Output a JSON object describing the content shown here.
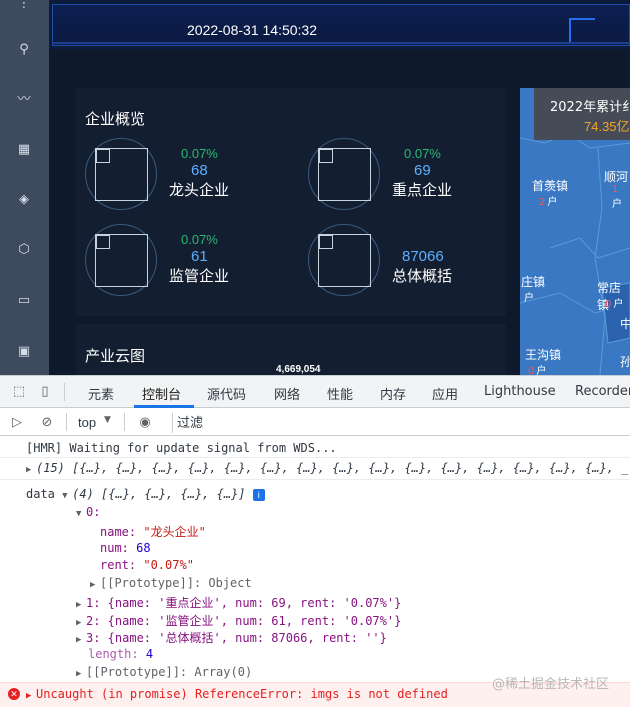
{
  "header": {
    "datetime": "2022-08-31 14:50:32"
  },
  "sidebar": {
    "items": [
      {
        "icon": "top-logo-icon",
        "glyph": "⋮"
      },
      {
        "icon": "network-icon",
        "glyph": "⚲"
      },
      {
        "icon": "trend-icon",
        "glyph": "〰"
      },
      {
        "icon": "chart-icon",
        "glyph": "▦"
      },
      {
        "icon": "cube-icon",
        "glyph": "◈"
      },
      {
        "icon": "shield-icon",
        "glyph": "⬡"
      },
      {
        "icon": "monitor-icon",
        "glyph": "▭"
      },
      {
        "icon": "briefcase-icon",
        "glyph": "▣"
      }
    ]
  },
  "overview": {
    "title": "企业概览",
    "stats": [
      {
        "rent": "0.07%",
        "num": "68",
        "name": "龙头企业"
      },
      {
        "rent": "0.07%",
        "num": "69",
        "name": "重点企业"
      },
      {
        "rent": "0.07%",
        "num": "61",
        "name": "监管企业"
      },
      {
        "rent": "",
        "num": "87066",
        "name": "总体概括"
      }
    ]
  },
  "cloud": {
    "title": "产业云图",
    "value": "4,669,054"
  },
  "map": {
    "tip_title": "2022年累计纟",
    "tip_value": "74.35亿",
    "towns": [
      {
        "name": "首羡镇",
        "count": "2",
        "unit": "户"
      },
      {
        "name": "顺河",
        "count": "1",
        "unit": "户"
      },
      {
        "name": "庄镇",
        "count": "",
        "unit": "户"
      },
      {
        "name": "常店镇",
        "count": "0",
        "unit": "户"
      },
      {
        "name": "王沟镇",
        "count": "0",
        "unit": "户"
      },
      {
        "name": "中",
        "count": "",
        "unit": ""
      },
      {
        "name": "孙",
        "count": "",
        "unit": ""
      }
    ]
  },
  "devtools": {
    "tabs": [
      "元素",
      "控制台",
      "源代码",
      "网络",
      "性能",
      "内存",
      "应用",
      "Lighthouse",
      "Recorder"
    ],
    "active_tab": "控制台",
    "context": "top",
    "filter_placeholder": "过滤",
    "console": {
      "hmr": "[HMR] Waiting for update signal from WDS...",
      "array15": "(15) [{…}, {…}, {…}, {…}, {…}, {…}, {…}, {…}, {…}, {…}, {…}, {…}, {…}, {…}, {…}, _",
      "data_label": "data",
      "data_summary": "(4) [{…}, {…}, {…}, {…}]",
      "item0_index": "0:",
      "item0_name_key": "name:",
      "item0_name_val": "\"龙头企业\"",
      "item0_num_key": "num:",
      "item0_num_val": "68",
      "item0_rent_key": "rent:",
      "item0_rent_val": "\"0.07%\"",
      "proto_object": "[[Prototype]]: Object",
      "item1": "1: {name: '重点企业', num: 69, rent: '0.07%'}",
      "item2": "2: {name: '监管企业', num: 61, rent: '0.07%'}",
      "item3": "3: {name: '总体概括', num: 87066, rent: ''}",
      "length_key": "length:",
      "length_val": "4",
      "proto_array": "[[Prototype]]: Array(0)",
      "error": "Uncaught (in promise) ReferenceError: imgs is not defined"
    },
    "watermark": "@稀土掘金技术社区"
  }
}
